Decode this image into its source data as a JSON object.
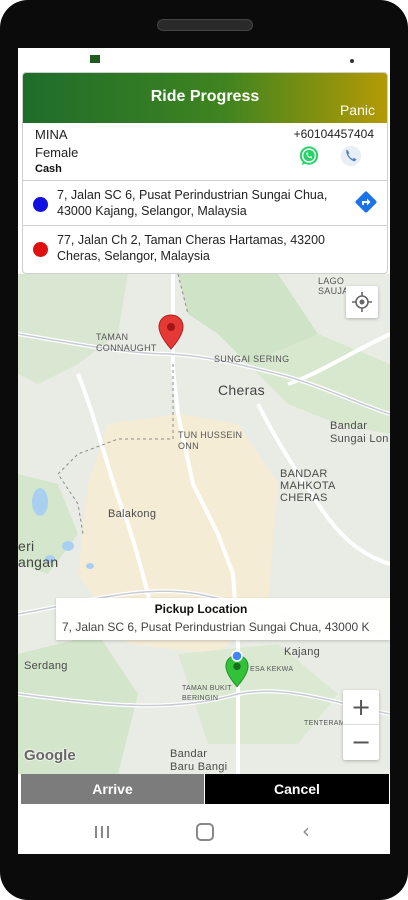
{
  "header": {
    "title": "Ride Progress",
    "panic_label": "Panic"
  },
  "rider": {
    "name": "MINA",
    "gender": "Female",
    "payment": "Cash",
    "phone": "+60104457404"
  },
  "pickup_address": "7, Jalan SC 6, Pusat Perindustrian Sungai Chua, 43000 Kajang, Selangor, Malaysia",
  "dropoff_address": "77, Jalan Ch 2, Taman Cheras Hartamas, 43200 Cheras, Selangor, Malaysia",
  "colors": {
    "pickup_dot": "#1010e0",
    "dropoff_dot": "#e01010",
    "header_start": "#1e6d2b",
    "header_end": "#b49a05",
    "arrive_bg": "#7c7c7c",
    "cancel_bg": "#000000"
  },
  "map": {
    "labels": {
      "taman_connaught": "TAMAN\nCONNAUGHT",
      "cheras": "Cheras",
      "sungai_sering": "SUNGAI SERING",
      "tun_hussein_onn": "TUN HUSSEIN\nONN",
      "bandar_sungai_long": "Bandar\nSungai Lon",
      "bandar_mahkota": "BANDAR\nMAHKOTA\nCHERAS",
      "balakong": "Balakong",
      "eri_langan": "eri\nangan",
      "serdang": "Serdang",
      "kajang": "Kajang",
      "taman_bukit": "TAMAN BUKIT\nBERINGIN",
      "desa_kekwa": "ESA KEKWA",
      "bandar_baru_bangi": "Bandar\nBaru Bangi",
      "tenteram": "TENTERAM",
      "lagoon": "LAGO\nSAUJANA"
    },
    "pickup_card_title": "Pickup Location",
    "pickup_card_address": "7, Jalan SC 6, Pusat Perindustrian Sungai Chua, 43000 K",
    "zoom_in": "+",
    "zoom_out": "−",
    "attribution": "Google"
  },
  "actions": {
    "arrive": "Arrive",
    "cancel": "Cancel"
  },
  "icons": {
    "whatsapp": "whatsapp-icon",
    "call": "phone-call-icon",
    "navigate": "directions-icon",
    "my_location": "my-location-icon"
  }
}
